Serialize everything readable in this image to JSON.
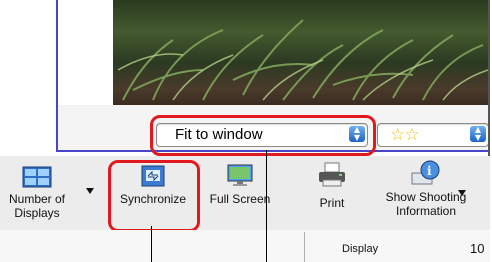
{
  "view": {
    "fit_select_value": "Fit to window",
    "rating_value": "☆☆",
    "rating_color": "#e9c31a"
  },
  "toolbar": {
    "items": [
      {
        "label_line1": "Number of",
        "label_line2": "Displays",
        "icon": "grid-display-icon",
        "has_dropdown": true
      },
      {
        "label_line1": "Synchronize",
        "label_line2": "",
        "icon": "synchronize-icon",
        "has_dropdown": false
      },
      {
        "label_line1": "Full Screen",
        "label_line2": "",
        "icon": "full-screen-icon",
        "has_dropdown": false
      },
      {
        "label_line1": "Print",
        "label_line2": "",
        "icon": "printer-icon",
        "has_dropdown": false
      },
      {
        "label_line1": "Show Shooting",
        "label_line2": "Information",
        "icon": "info-icon",
        "has_dropdown": true
      }
    ]
  },
  "status": {
    "display_label": "Display",
    "display_value": "10"
  },
  "colors": {
    "highlight": "#e1191d",
    "accent_blue": "#4a44c8"
  }
}
